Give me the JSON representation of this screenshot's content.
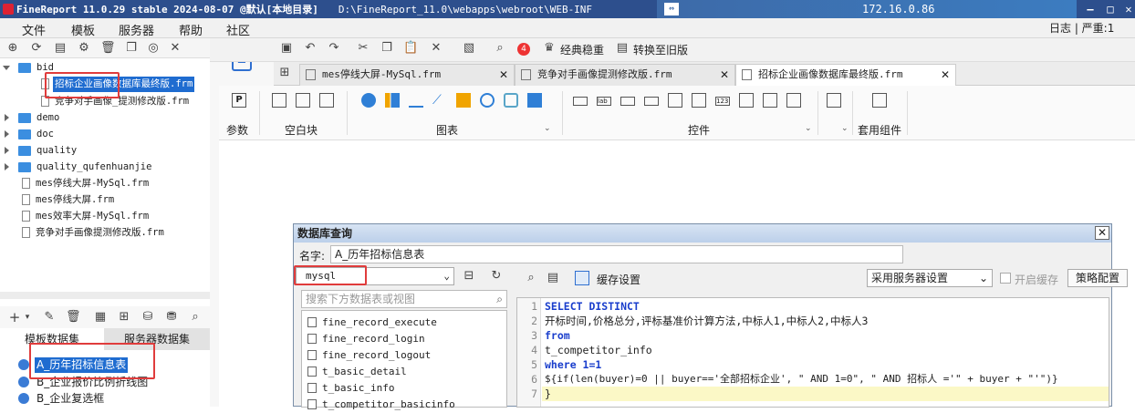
{
  "window": {
    "title": "FineReport 11.0.29 stable 2024-08-07 @默认[本地目录]",
    "path": "D:\\FineReport_11.0\\webapps\\webroot\\WEB-INF",
    "remote_ip": "172.16.0.86"
  },
  "menu": [
    "文件",
    "模板",
    "服务器",
    "帮助",
    "社区"
  ],
  "status_right": "日志 | 严重:1",
  "tree": {
    "items": [
      {
        "label": "bid",
        "type": "folder",
        "open": true
      },
      {
        "label": "招标企业画像数据库最终版.frm",
        "type": "file",
        "selected": true
      },
      {
        "label": "竞争对手画像_提测修改版.frm",
        "type": "file"
      },
      {
        "label": "demo",
        "type": "folder"
      },
      {
        "label": "doc",
        "type": "folder"
      },
      {
        "label": "quality",
        "type": "folder"
      },
      {
        "label": "quality_qufenhuanjie",
        "type": "folder"
      },
      {
        "label": "mes停线大屏-MySql.frm",
        "type": "file"
      },
      {
        "label": "mes停线大屏.frm",
        "type": "file"
      },
      {
        "label": "mes效率大屏-MySql.frm",
        "type": "file"
      },
      {
        "label": "竞争对手画像提测修改版.frm",
        "type": "file"
      }
    ]
  },
  "dataset_tabs": [
    "模板数据集",
    "服务器数据集"
  ],
  "datasets": [
    "A_历年招标信息表",
    "B_企业报价比例折线图",
    "B_企业复选框"
  ],
  "toolbar": {
    "badge_count": "4",
    "classic_label": "经典稳重",
    "switch_label": "转换至旧版"
  },
  "doc_tabs": [
    {
      "label": "mes停线大屏-MySql.frm",
      "active": false
    },
    {
      "label": "竞争对手画像提测修改版.frm",
      "active": false
    },
    {
      "label": "招标企业画像数据库最终版.frm",
      "active": true
    }
  ],
  "ribbon": {
    "params_label": "参数",
    "blank_label": "空白块",
    "chart_label": "图表",
    "control_label": "控件",
    "suite_label": "套用组件"
  },
  "dialog": {
    "title": "数据库查询",
    "name_label": "名字:",
    "name_value": "A_历年招标信息表",
    "db_value": "mysql",
    "search_placeholder": "搜索下方数据表或视图",
    "tables": [
      "fine_record_execute",
      "fine_record_login",
      "fine_record_logout",
      "t_basic_detail",
      "t_basic_info",
      "t_competitor_basicinfo"
    ],
    "cache_label": "缓存设置",
    "cache_value": "采用服务器设置",
    "enable_cache_label": "开启缓存",
    "strategy_label": "策略配置",
    "sql_lines": [
      "SELECT DISTINCT",
      "开标时间,价格总分,评标基准价计算方法,中标人1,中标人2,中标人3",
      "from",
      "t_competitor_info",
      "where 1=1",
      "${if(len(buyer)=0 || buyer=='全部招标企业', \" AND 1=0\", \" AND 招标人 ='\" + buyer + \"'\")}",
      "}"
    ]
  }
}
